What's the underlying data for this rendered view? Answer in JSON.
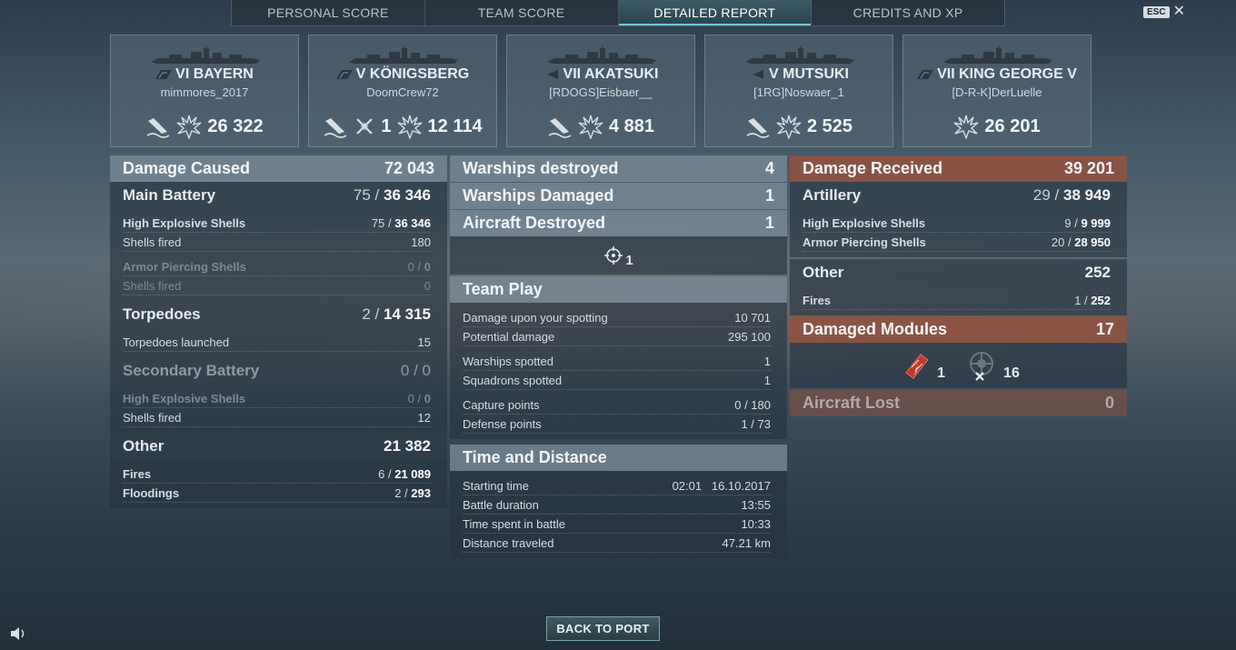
{
  "tabs": [
    {
      "label": "PERSONAL SCORE"
    },
    {
      "label": "TEAM SCORE"
    },
    {
      "label": "DETAILED REPORT"
    },
    {
      "label": "CREDITS AND XP"
    }
  ],
  "esc": {
    "key": "ESC"
  },
  "ships": [
    {
      "tier": "VI",
      "name": "BAYERN",
      "label": "VI BAYERN",
      "player": "mimmores_2017",
      "damage": "26 322",
      "planes": ""
    },
    {
      "tier": "V",
      "name": "KÖNIGSBERG",
      "label": "V KÖNIGSBERG",
      "player": "DoomCrew72",
      "damage": "12 114",
      "planes": "1"
    },
    {
      "tier": "VII",
      "name": "AKATSUKI",
      "label": "VII AKATSUKI",
      "player": "[RDOGS]Eisbaer__",
      "damage": "4 881",
      "planes": ""
    },
    {
      "tier": "V",
      "name": "MUTSUKI",
      "label": "V MUTSUKI",
      "player": "[1RG]Noswaer_1",
      "damage": "2 525",
      "planes": ""
    },
    {
      "tier": "VII",
      "name": "KING GEORGE V",
      "label": "VII KING GEORGE V",
      "player": "[D-R-K]DerLuelle",
      "damage": "26 201",
      "planes": ""
    }
  ],
  "left": {
    "damage_caused": {
      "label": "Damage Caused",
      "value": "72 043"
    },
    "main_battery": {
      "label": "Main Battery",
      "hits": "75 /",
      "dmg": "36 346"
    },
    "he": {
      "label": "High Explosive Shells",
      "hits": "75 /",
      "dmg": "36 346"
    },
    "he_fired": {
      "label": "Shells fired",
      "value": "180"
    },
    "ap": {
      "label": "Armor Piercing Shells",
      "hits": "0 /",
      "dmg": "0"
    },
    "ap_fired": {
      "label": "Shells fired",
      "value": "0"
    },
    "torpedoes": {
      "label": "Torpedoes",
      "hits": "2 /",
      "dmg": "14 315"
    },
    "torp_launched": {
      "label": "Torpedoes launched",
      "value": "15"
    },
    "secondary": {
      "label": "Secondary Battery",
      "hits": "0 /",
      "dmg": "0"
    },
    "sec_he": {
      "label": "High Explosive Shells",
      "hits": "0 /",
      "dmg": "0"
    },
    "sec_fired": {
      "label": "Shells fired",
      "value": "12"
    },
    "other": {
      "label": "Other",
      "value": "21 382"
    },
    "fires": {
      "label": "Fires",
      "hits": "6 /",
      "dmg": "21 089"
    },
    "floodings": {
      "label": "Floodings",
      "hits": "2 /",
      "dmg": "293"
    }
  },
  "middle": {
    "destroyed": {
      "label": "Warships destroyed",
      "value": "4"
    },
    "damaged": {
      "label": "Warships Damaged",
      "value": "1"
    },
    "aircraft": {
      "label": "Aircraft Destroyed",
      "value": "1"
    },
    "aircraft_icon_count": "1",
    "team_play": {
      "label": "Team Play"
    },
    "spotting_dmg": {
      "label": "Damage upon your spotting",
      "value": "10 701"
    },
    "potential": {
      "label": "Potential damage",
      "value": "295 100"
    },
    "ships_spotted": {
      "label": "Warships spotted",
      "value": "1"
    },
    "squadrons_spotted": {
      "label": "Squadrons spotted",
      "value": "1"
    },
    "capture": {
      "label": "Capture points",
      "value": "0 / 180"
    },
    "defense": {
      "label": "Defense points",
      "value": "1 / 73"
    },
    "time_distance": {
      "label": "Time and Distance"
    },
    "start": {
      "label": "Starting time",
      "value": "02:01   16.10.2017"
    },
    "duration": {
      "label": "Battle duration",
      "value": "13:55"
    },
    "time_spent": {
      "label": "Time spent in battle",
      "value": "10:33"
    },
    "distance": {
      "label": "Distance traveled",
      "value": "47.21 km"
    }
  },
  "right": {
    "received": {
      "label": "Damage Received",
      "value": "39 201"
    },
    "artillery": {
      "label": "Artillery",
      "hits": "29 /",
      "dmg": "38 949"
    },
    "he": {
      "label": "High Explosive Shells",
      "hits": "9 /",
      "dmg": "9 999"
    },
    "ap": {
      "label": "Armor Piercing Shells",
      "hits": "20 /",
      "dmg": "28 950"
    },
    "other": {
      "label": "Other",
      "value": "252"
    },
    "fires": {
      "label": "Fires",
      "hits": "1 /",
      "dmg": "252"
    },
    "modules": {
      "label": "Damaged Modules",
      "value": "17"
    },
    "module_a_count": "1",
    "module_b_count": "16",
    "aircraft_lost": {
      "label": "Aircraft Lost",
      "value": "0"
    }
  },
  "back_button": "BACK TO PORT",
  "colors": {
    "accent": "#6fc7d6",
    "received": "#965040",
    "panel": "#56687a"
  }
}
